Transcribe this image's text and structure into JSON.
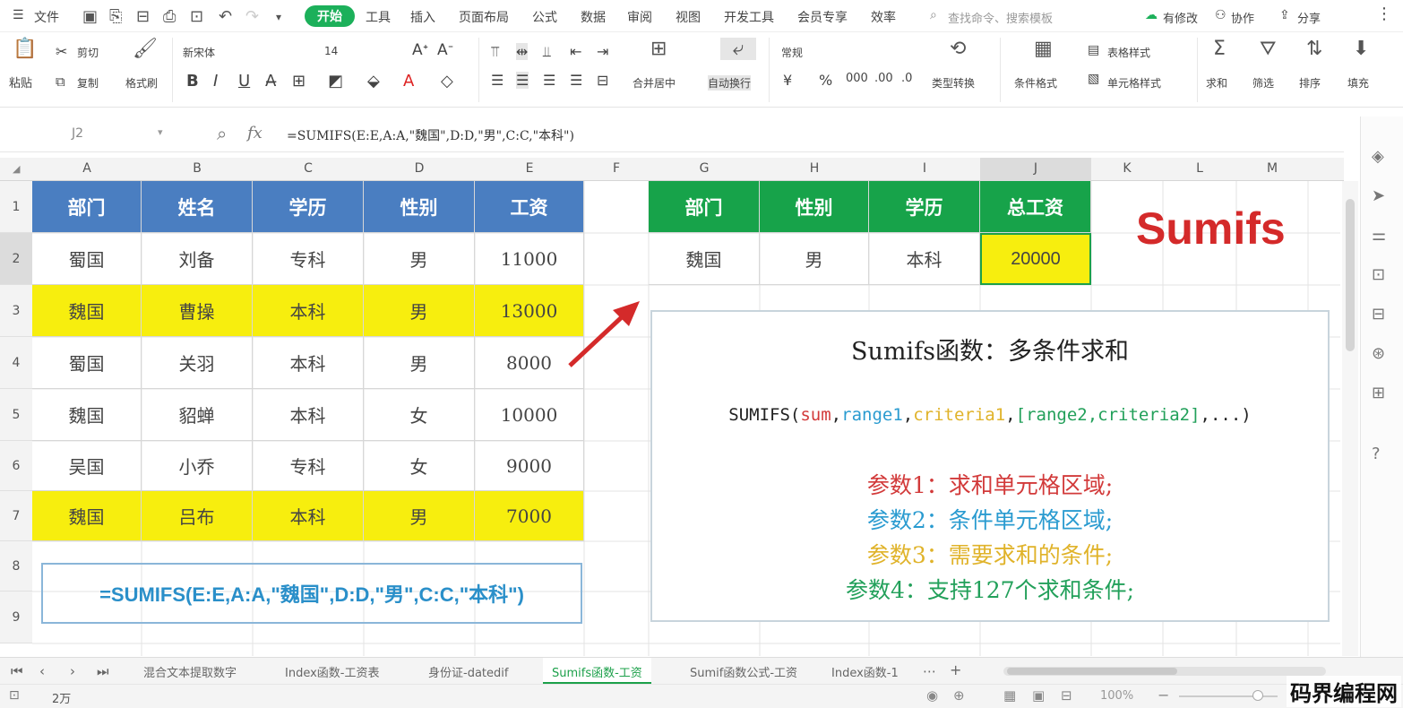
{
  "menubar": {
    "file_label": "文件",
    "tabs": [
      "开始",
      "工具",
      "插入",
      "页面布局",
      "公式",
      "数据",
      "审阅",
      "视图",
      "开发工具",
      "会员专享",
      "效率"
    ],
    "search_placeholder": "查找命令、搜索模板",
    "edited_label": "有修改",
    "collab_label": "协作",
    "share_label": "分享"
  },
  "ribbon": {
    "paste": "粘贴",
    "cut": "剪切",
    "copy": "复制",
    "format_painter": "格式刷",
    "font_name": "新宋体",
    "font_size": "14",
    "merge_center": "合并居中",
    "wrap_text": "自动换行",
    "number_format": "常规",
    "type_convert": "类型转换",
    "cond_format": "条件格式",
    "table_style": "表格样式",
    "cell_style": "单元格样式",
    "sum": "求和",
    "filter": "筛选",
    "sort": "排序",
    "fill": "填充"
  },
  "formula_bar": {
    "name_box": "J2",
    "fx": "fx",
    "formula": "=SUMIFS(E:E,A:A,\"魏国\",D:D,\"男\",C:C,\"本科\")"
  },
  "columns": [
    "A",
    "B",
    "C",
    "D",
    "E",
    "F",
    "G",
    "H",
    "I",
    "J",
    "K",
    "L",
    "M"
  ],
  "rows": [
    "1",
    "2",
    "3",
    "4",
    "5",
    "6",
    "7",
    "8",
    "9"
  ],
  "left_table": {
    "headers": [
      "部门",
      "姓名",
      "学历",
      "性别",
      "工资"
    ],
    "rows": [
      [
        "蜀国",
        "刘备",
        "专科",
        "男",
        "11000"
      ],
      [
        "魏国",
        "曹操",
        "本科",
        "男",
        "13000"
      ],
      [
        "蜀国",
        "关羽",
        "本科",
        "男",
        "8000"
      ],
      [
        "魏国",
        "貂蝉",
        "本科",
        "女",
        "10000"
      ],
      [
        "吴国",
        "小乔",
        "专科",
        "女",
        "9000"
      ],
      [
        "魏国",
        "吕布",
        "本科",
        "男",
        "7000"
      ]
    ]
  },
  "right_table": {
    "headers": [
      "部门",
      "性别",
      "学历",
      "总工资"
    ],
    "row": [
      "魏国",
      "男",
      "本科",
      "20000"
    ]
  },
  "title_text": "Sumifs",
  "formula_box": "=SUMIFS(E:E,A:A,\"魏国\",D:D,\"男\",C:C,\"本科\")",
  "explain": {
    "title": "Sumifs函数：多条件求和",
    "syntax": {
      "fn": "SUMIFS(",
      "p1": "sum",
      "c1": ",",
      "p2": "range1",
      "c2": ",",
      "p3": "criteria1",
      "c3": ",",
      "p4": "[range2,criteria2]",
      "tail": ",...)"
    },
    "params": [
      "参数1：求和单元格区域;",
      "参数2：条件单元格区域;",
      "参数3：需要求和的条件;",
      "参数4：支持127个求和条件;"
    ],
    "param_colors": [
      "#d23a3a",
      "#2a9bd0",
      "#e0b32a",
      "#22a05a"
    ]
  },
  "sheet_tabs": [
    "混合文本提取数字",
    "Index函数-工资表",
    "身份证-datedif",
    "Sumifs函数-工资",
    "Sumif函数公式-工资",
    "Index函数-1"
  ],
  "active_tab_index": 3,
  "status": {
    "count_label": "2万",
    "zoom": "100%"
  },
  "watermark": "码界编程网"
}
